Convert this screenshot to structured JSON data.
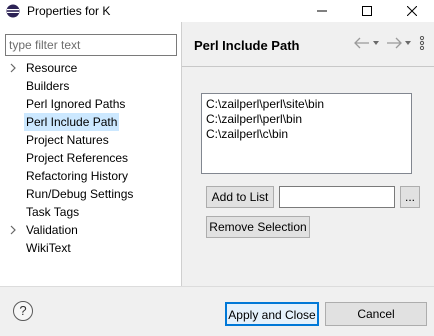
{
  "window": {
    "title": "Properties for K"
  },
  "filter": {
    "placeholder": "type filter text"
  },
  "tree": {
    "items": [
      {
        "label": "Resource",
        "expandable": true,
        "selected": false
      },
      {
        "label": "Builders",
        "expandable": false,
        "selected": false
      },
      {
        "label": "Perl Ignored Paths",
        "expandable": false,
        "selected": false
      },
      {
        "label": "Perl Include Path",
        "expandable": false,
        "selected": true
      },
      {
        "label": "Project Natures",
        "expandable": false,
        "selected": false
      },
      {
        "label": "Project References",
        "expandable": false,
        "selected": false
      },
      {
        "label": "Refactoring History",
        "expandable": false,
        "selected": false
      },
      {
        "label": "Run/Debug Settings",
        "expandable": false,
        "selected": false
      },
      {
        "label": "Task Tags",
        "expandable": false,
        "selected": false
      },
      {
        "label": "Validation",
        "expandable": true,
        "selected": false
      },
      {
        "label": "WikiText",
        "expandable": false,
        "selected": false
      }
    ]
  },
  "page": {
    "title": "Perl Include Path",
    "paths": [
      "C:\\zailperl\\perl\\site\\bin",
      "C:\\zailperl\\perl\\bin",
      "C:\\zailperl\\c\\bin"
    ],
    "add_to_list_label": "Add to List",
    "add_input_value": "",
    "browse_label": "...",
    "remove_selection_label": "Remove Selection"
  },
  "buttons": {
    "apply_close_label": "Apply and Close",
    "cancel_label": "Cancel"
  },
  "icons": {
    "app": "eclipse-icon",
    "help": "help-icon",
    "back": "back-arrow-icon",
    "forward": "forward-arrow-icon",
    "menu": "view-menu-icon"
  },
  "colors": {
    "selection": "#cce8ff",
    "default_button_border": "#0078d7",
    "app_icon": "#2c2255"
  }
}
